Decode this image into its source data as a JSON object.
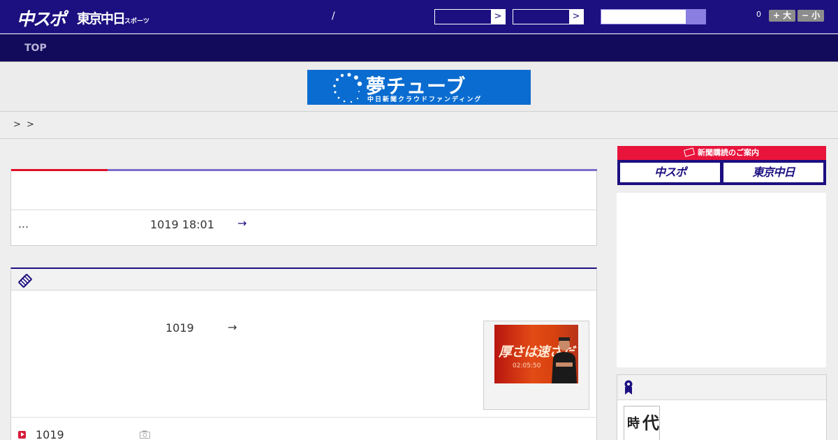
{
  "header": {
    "logo_main": "中スポ",
    "logo_sub": "東京中日",
    "logo_sub_small": "スポーツ",
    "separator": "/",
    "select1_arrow": ">",
    "select2_arrow": ">",
    "font_count": "0",
    "font_bigger": "+ 大",
    "font_smaller": "− 小"
  },
  "nav": {
    "top_label": "TOP"
  },
  "banner": {
    "title": "夢チューブ",
    "subtitle": "中日新聞クラウドファンディング"
  },
  "breadcrumb": {
    "sep1": ">",
    "sep2": ">"
  },
  "news_box": {
    "ellipsis": "…",
    "date": "1019 18:01",
    "arrow": "→"
  },
  "video_box": {
    "date": "1019",
    "arrow": "→",
    "thumb_caption": "厚さは速さだ",
    "thumb_time": "02:05:50",
    "list_date": "1019"
  },
  "sidebar": {
    "subscribe_header": "新聞購読のご案内",
    "subscribe_btn1": "中スポ",
    "subscribe_btn2": "東京中日",
    "ranking_thumb_k1": "時",
    "ranking_thumb_k2": "代"
  },
  "colors": {
    "brand_navy": "#1c0f80",
    "accent_red": "#e8143c",
    "accent_purple": "#7b6fc9"
  }
}
